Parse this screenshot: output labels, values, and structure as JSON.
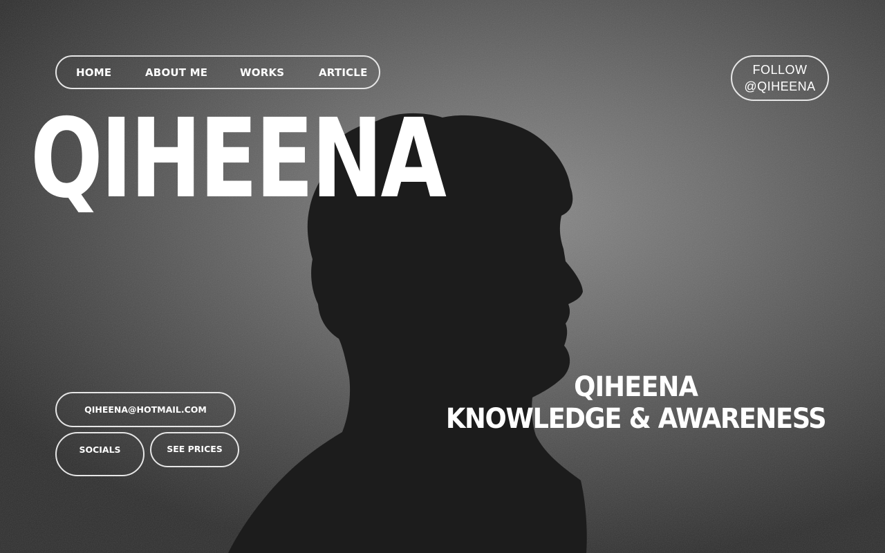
{
  "nav": {
    "items": [
      {
        "label": "HOME"
      },
      {
        "label": "ABOUT ME"
      },
      {
        "label": "WORKS"
      },
      {
        "label": "ARTICLE"
      }
    ]
  },
  "follow": {
    "line1": "FOLLOW",
    "line2": "@QIHEENA"
  },
  "brand": {
    "title": "QIHEENA"
  },
  "contact": {
    "email": "QIHEENA@HOTMAIL.COM",
    "socials": "SOCIALS",
    "prices": "SEE PRICES"
  },
  "tagline": {
    "line1": "QIHEENA",
    "line2": "KNOWLEDGE & AWARENESS"
  },
  "colors": {
    "background": "#6c6c6c",
    "silhouette": "#1c1c1c",
    "text": "#ffffff",
    "outline": "#e6e6e6"
  }
}
